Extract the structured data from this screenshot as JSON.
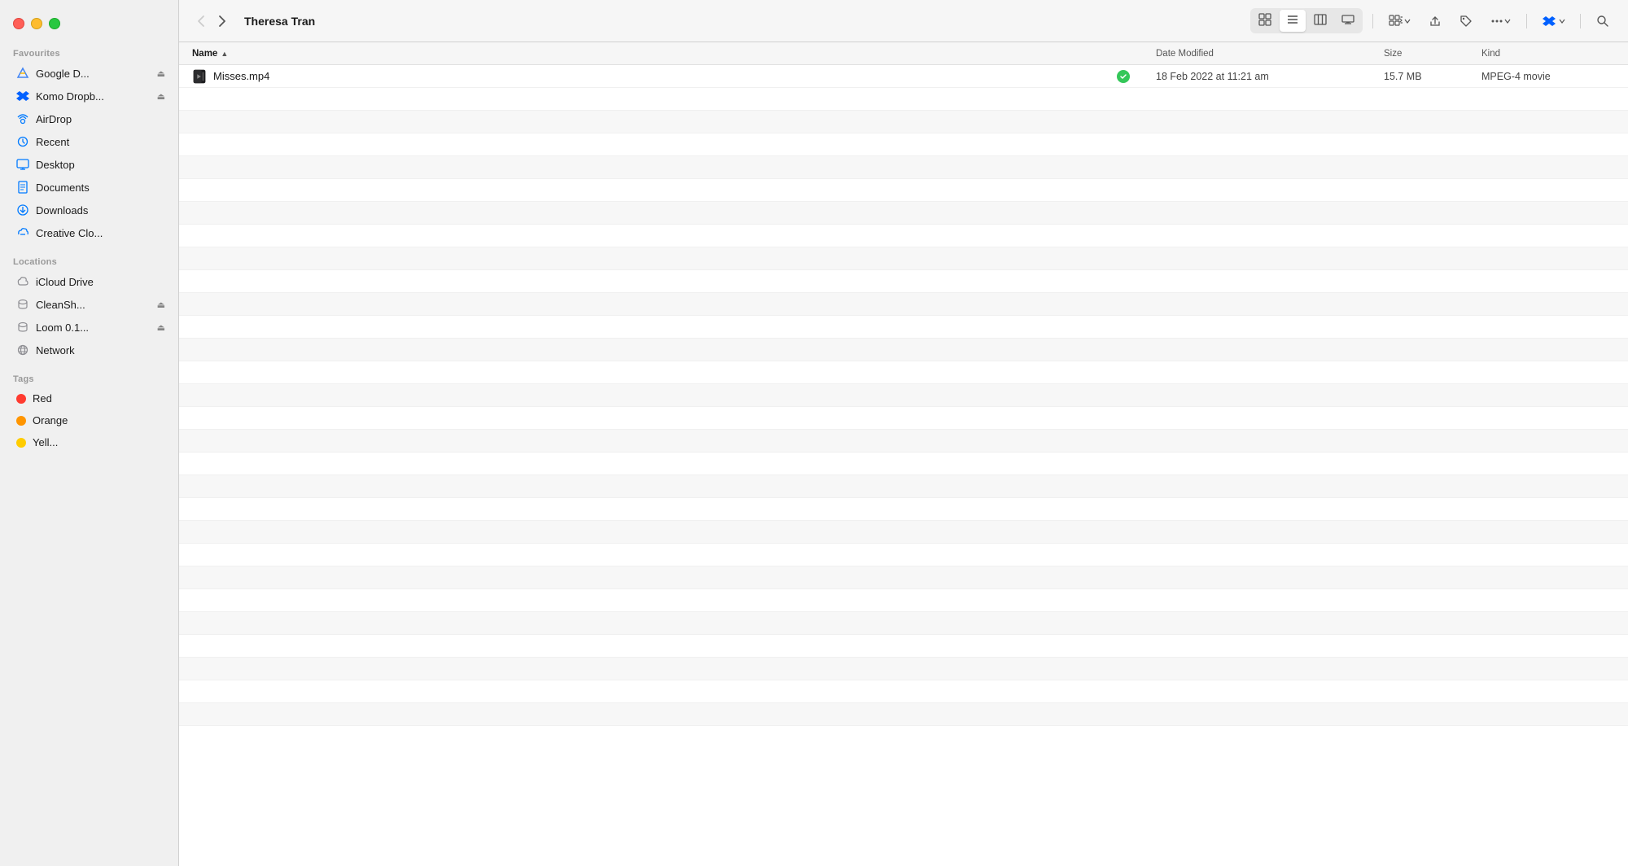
{
  "window": {
    "title": "Theresa Tran",
    "traffic": {
      "close": "close",
      "minimize": "minimize",
      "maximize": "maximize"
    }
  },
  "sidebar": {
    "sections": {
      "favourites": {
        "label": "Favourites",
        "items": [
          {
            "id": "google-drive",
            "label": "Google D...",
            "icon": "google-drive-icon",
            "eject": true
          },
          {
            "id": "komo-dropbox",
            "label": "Komo Dropb...",
            "icon": "dropbox-icon",
            "eject": true
          },
          {
            "id": "airdrop",
            "label": "AirDrop",
            "icon": "airdrop-icon",
            "eject": false
          },
          {
            "id": "recent",
            "label": "Recent",
            "icon": "recent-icon",
            "eject": false
          },
          {
            "id": "desktop",
            "label": "Desktop",
            "icon": "desktop-icon",
            "eject": false
          },
          {
            "id": "documents",
            "label": "Documents",
            "icon": "documents-icon",
            "eject": false
          },
          {
            "id": "downloads",
            "label": "Downloads",
            "icon": "downloads-icon",
            "eject": false
          },
          {
            "id": "creative-cloud",
            "label": "Creative Clo...",
            "icon": "creative-cloud-icon",
            "eject": false
          }
        ]
      },
      "locations": {
        "label": "Locations",
        "items": [
          {
            "id": "icloud-drive",
            "label": "iCloud Drive",
            "icon": "icloud-icon",
            "eject": false
          },
          {
            "id": "cleansh",
            "label": "CleanSh...",
            "icon": "drive-icon",
            "eject": true
          },
          {
            "id": "loom",
            "label": "Loom 0.1...",
            "icon": "drive-icon",
            "eject": true
          },
          {
            "id": "network",
            "label": "Network",
            "icon": "network-icon",
            "eject": false
          }
        ]
      },
      "tags": {
        "label": "Tags",
        "items": [
          {
            "id": "red",
            "label": "Red",
            "color": "#ff3b30"
          },
          {
            "id": "orange",
            "label": "Orange",
            "color": "#ff9500"
          },
          {
            "id": "yellow",
            "label": "Yell...",
            "color": "#ffcc00"
          }
        ]
      }
    }
  },
  "toolbar": {
    "back_disabled": true,
    "forward_disabled": false,
    "view_options": [
      "icon-view",
      "list-view",
      "column-view",
      "gallery-view"
    ],
    "active_view": "list-view",
    "actions": [
      "group-by",
      "share",
      "tag",
      "more",
      "dropbox",
      "search"
    ]
  },
  "columns": {
    "name": {
      "label": "Name",
      "sort": "asc",
      "active": true
    },
    "date_modified": {
      "label": "Date Modified"
    },
    "size": {
      "label": "Size"
    },
    "kind": {
      "label": "Kind"
    }
  },
  "files": [
    {
      "name": "Misses.mp4",
      "icon": "video-file",
      "date_modified": "18 Feb 2022 at 11:21 am",
      "size": "15.7 MB",
      "kind": "MPEG-4 movie",
      "synced": true
    }
  ],
  "empty_rows": 28
}
